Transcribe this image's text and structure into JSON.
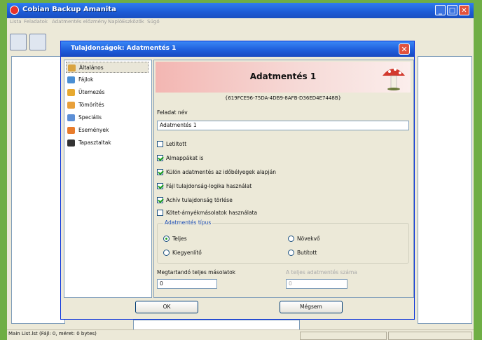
{
  "app": {
    "title": "Cobian Backup Amanita",
    "menu": [
      "Lista",
      "Feladatok",
      "Adatmentés előzmény",
      "Napló",
      "Eszközök",
      "Súgó"
    ]
  },
  "status": {
    "text": "Main List.lst (Fájl: 0, méret: 0 bytes)"
  },
  "dialog": {
    "title": "Tulajdonságok: Adatmentés 1",
    "nav": [
      {
        "label": "Általános",
        "icon": "general-icon",
        "color": "#d9a441"
      },
      {
        "label": "Fájlok",
        "icon": "files-icon",
        "color": "#4a8fd4"
      },
      {
        "label": "Ütemezés",
        "icon": "schedule-icon",
        "color": "#e7a92f"
      },
      {
        "label": "Tömörítés",
        "icon": "archive-icon",
        "color": "#e8a03a"
      },
      {
        "label": "Speciális",
        "icon": "special-icon",
        "color": "#5c8fd6"
      },
      {
        "label": "Események",
        "icon": "events-icon",
        "color": "#e87c2c"
      },
      {
        "label": "Tapasztaltak",
        "icon": "advanced-icon",
        "color": "#333333"
      }
    ],
    "banner_title": "Adatmentés 1",
    "guid": "{619FCE96-75DA-4DB9-8AFB-D36ED4E7448B}",
    "task_name_label": "Feladat név",
    "task_name_value": "Adatmentés 1",
    "checkboxes": [
      {
        "label": "Letiltott",
        "checked": false
      },
      {
        "label": "Almappákat is",
        "checked": true
      },
      {
        "label": "Külön adatmentés az időbélyegek alapján",
        "checked": true
      },
      {
        "label": "Fájl tulajdonság-logika használat",
        "checked": true
      },
      {
        "label": "Achív tulajdonság törlése",
        "checked": true
      },
      {
        "label": "Kötet-árnyékmásolatok használata",
        "checked": false
      }
    ],
    "backup_type": {
      "title": "Adatmentés típus",
      "options": [
        {
          "label": "Teljes",
          "selected": true
        },
        {
          "label": "Növekvő",
          "selected": false
        },
        {
          "label": "Kiegyenlítő",
          "selected": false
        },
        {
          "label": "Butított",
          "selected": false
        }
      ]
    },
    "full_copies_label": "Megtartandó teljes másolatok",
    "full_copies_value": "0",
    "full_count_label": "A teljes adatmentés száma",
    "full_count_value": "0",
    "ok_label": "OK",
    "cancel_label": "Mégsem"
  }
}
